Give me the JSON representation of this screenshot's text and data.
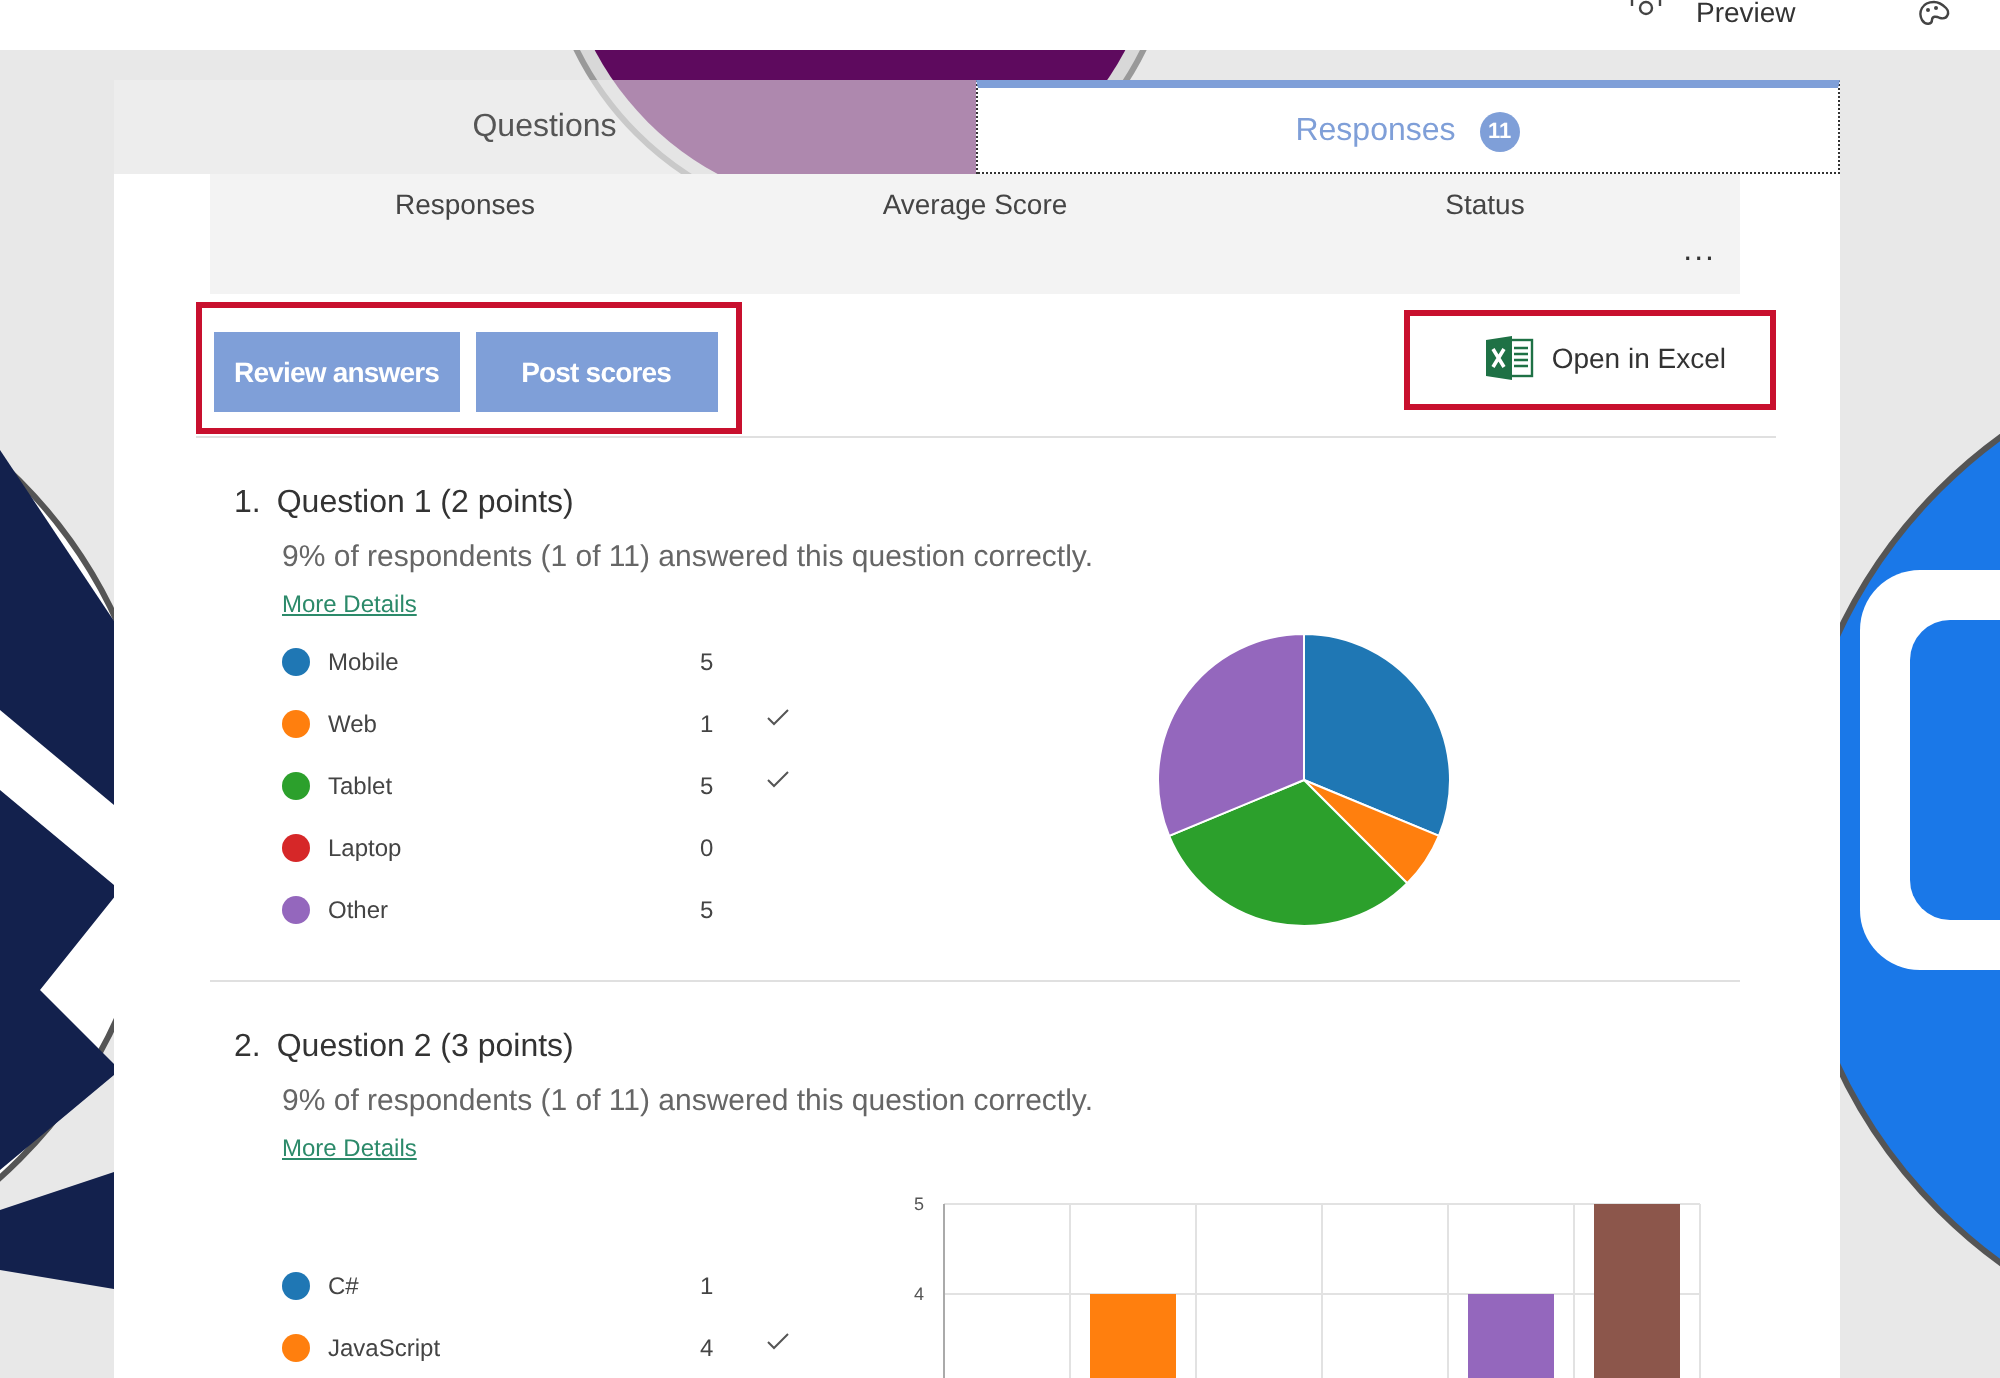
{
  "top_bar": {
    "preview": "Preview"
  },
  "tabs": [
    {
      "label": "Questions",
      "selected": false
    },
    {
      "label": "Responses",
      "selected": true,
      "badge": "11"
    }
  ],
  "summary": {
    "columns": [
      "Responses",
      "Average Score",
      "Status"
    ],
    "more": "..."
  },
  "actions": {
    "highlighted": true,
    "buttons": [
      "Review answers",
      "Post scores"
    ]
  },
  "excel": {
    "highlighted": true,
    "label": "Open in Excel"
  },
  "questions": [
    {
      "number": "1.",
      "title": "Question 1 (2 points)",
      "result": "9% of respondents (1 of 11) answered this question correctly.",
      "link": "More Details",
      "options": [
        {
          "label": "Mobile",
          "count": "5",
          "color": "#1f77b4",
          "correct": false
        },
        {
          "label": "Web",
          "count": "1",
          "color": "#ff7f0e",
          "correct": true
        },
        {
          "label": "Tablet",
          "count": "5",
          "color": "#2ca02c",
          "correct": true
        },
        {
          "label": "Laptop",
          "count": "0",
          "color": "#d62728",
          "correct": false
        },
        {
          "label": "Other",
          "count": "5",
          "color": "#9467bd",
          "correct": false
        }
      ],
      "chart_data": {
        "type": "pie",
        "values": [
          31.25,
          6.25,
          31.25,
          0,
          31.25
        ]
      }
    },
    {
      "number": "2.",
      "title": "Question 2 (3 points)",
      "result": "9% of respondents (1 of 11) answered this question correctly.",
      "link": "More Details",
      "options": [
        {
          "label": "C#",
          "count": "1",
          "color": "#1f77b4",
          "correct": false
        },
        {
          "label": "JavaScript",
          "count": "4",
          "color": "#ff7f0e",
          "correct": true
        }
      ],
      "chart_data": {
        "type": "bar",
        "ylim": [
          0,
          5
        ],
        "yticks": [
          4,
          5
        ],
        "values": [
          null,
          4,
          null,
          null,
          4,
          5
        ],
        "colors": [
          null,
          "#ff7f0e",
          null,
          null,
          "#9467bd",
          "#8c564b"
        ]
      }
    }
  ]
}
